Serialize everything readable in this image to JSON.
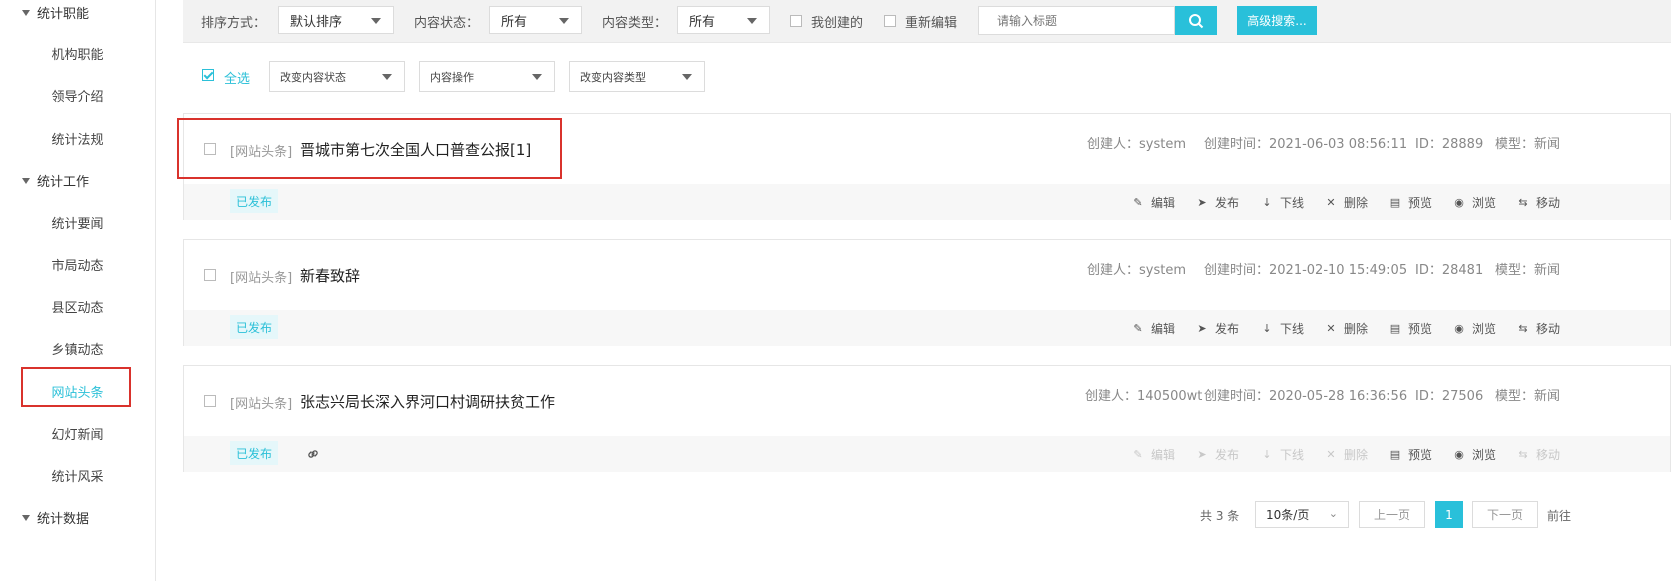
{
  "sidebar": {
    "groups": [
      "统计职能",
      "统计工作",
      "统计数据"
    ],
    "items": [
      "机构职能",
      "领导介绍",
      "统计法规",
      "统计要闻",
      "市局动态",
      "县区动态",
      "乡镇动态",
      "网站头条",
      "幻灯新闻",
      "统计风采"
    ]
  },
  "toolbar": {
    "sort_label": "排序方式：",
    "sort_value": "默认排序",
    "status_label": "内容状态：",
    "status_value": "所有",
    "type_label": "内容类型：",
    "type_value": "所有",
    "my_created": "我创建的",
    "re_edit": "重新编辑",
    "search_placeholder": "请输入标题",
    "advanced_search": "高级搜索..."
  },
  "batch": {
    "select_all": "全选",
    "change_status": "改变内容状态",
    "content_ops": "内容操作",
    "change_type": "改变内容类型"
  },
  "labels": {
    "creator": "创建人：",
    "created_time": "创建时间：",
    "id": "ID：",
    "model": "模型："
  },
  "actions": [
    "编辑",
    "发布",
    "下线",
    "删除",
    "预览",
    "浏览",
    "移动"
  ],
  "articles": [
    {
      "tag": "[网站头条]",
      "title": "晋城市第七次全国人口普查公报[1]",
      "creator": "system",
      "time": "2021-06-03 08:56:11",
      "id": "28889",
      "model": "新闻",
      "status": "已发布"
    },
    {
      "tag": "[网站头条]",
      "title": "新春致辞",
      "creator": "system",
      "time": "2021-02-10 15:49:05",
      "id": "28481",
      "model": "新闻",
      "status": "已发布"
    },
    {
      "tag": "[网站头条]",
      "title": "张志兴局长深入界河口村调研扶贫工作",
      "creator": "140500wt",
      "time": "2020-05-28 16:36:56",
      "id": "27506",
      "model": "新闻",
      "status": "已发布"
    }
  ],
  "pager": {
    "total": "共 3 条",
    "page_size": "10条/页",
    "prev": "上一页",
    "current": "1",
    "next": "下一页",
    "goto": "前往"
  }
}
